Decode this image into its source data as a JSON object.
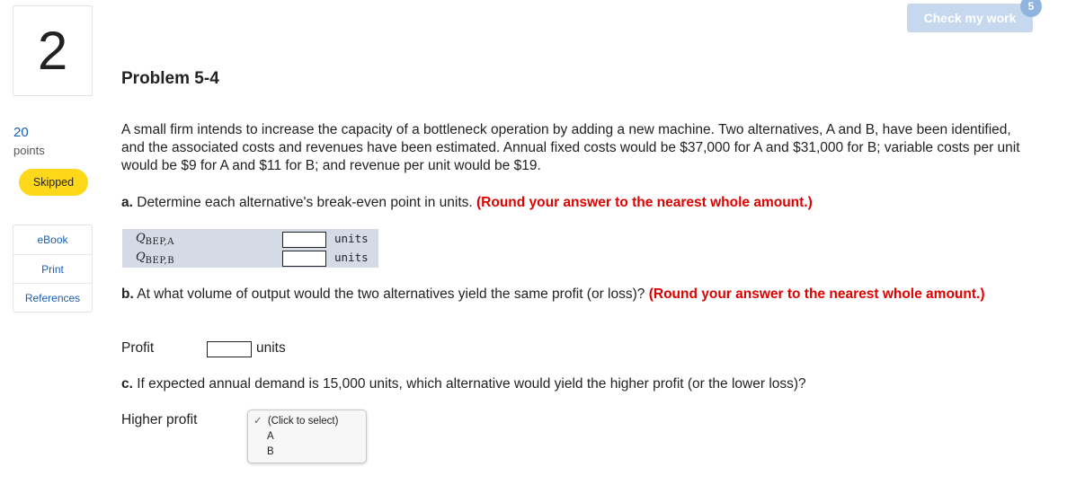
{
  "question_number": "2",
  "points": {
    "value": "20",
    "label": "points"
  },
  "status_badge": "Skipped",
  "resources": [
    "eBook",
    "Print",
    "References"
  ],
  "header": {
    "check_label": "Check my work",
    "check_badge": "5"
  },
  "problem_title": "Problem 5-4",
  "intro": "A small firm intends to increase the capacity of a bottleneck operation by adding a new machine. Two alternatives, A and B, have been identified, and the associated costs and revenues have been estimated. Annual fixed costs would be $37,000 for A and $31,000 for B; variable costs per unit would be $9 for A and $11 for B; and revenue per unit would be $19.",
  "part_a": {
    "prefix": "a.",
    "text": " Determine each alternative's break-even point in units. ",
    "note": "(Round your answer to the nearest whole amount.)",
    "rows": [
      {
        "symbol": "Q",
        "subscript": "BEP,A",
        "value": "",
        "unit": "units"
      },
      {
        "symbol": "Q",
        "subscript": "BEP,B",
        "value": "",
        "unit": "units"
      }
    ]
  },
  "part_b": {
    "prefix": "b.",
    "text": " At what volume of output would the two alternatives yield the same profit (or loss)? ",
    "note": "(Round your answer to the nearest whole amount.)",
    "label": "Profit",
    "value": "",
    "unit": "units"
  },
  "part_c": {
    "prefix": "c.",
    "text": " If expected annual demand is 15,000 units, which alternative would yield the higher profit (or the lower loss)?",
    "label": "Higher profit",
    "select": {
      "checkmark": "✓",
      "placeholder": "(Click to select)",
      "options": [
        "A",
        "B"
      ]
    }
  }
}
